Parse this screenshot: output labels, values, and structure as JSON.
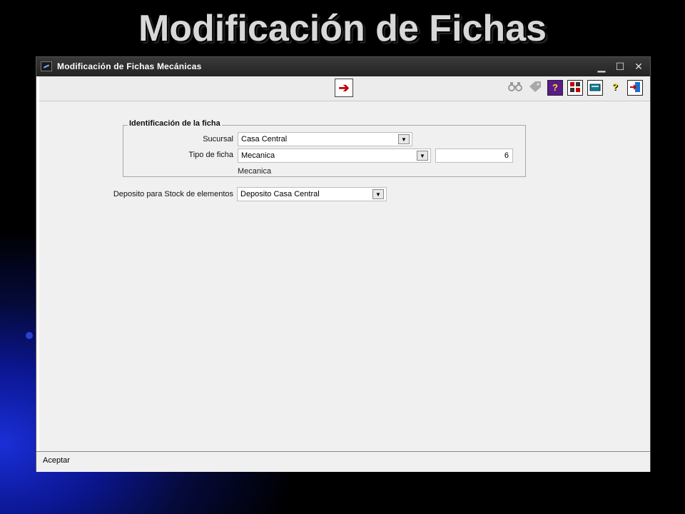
{
  "slide": {
    "title": "Modificación de Fichas"
  },
  "window": {
    "title": "Modificación de Fichas Mecánicas",
    "controls": {
      "minimize": "▁",
      "maximize": "☐",
      "close": "✕"
    }
  },
  "toolbar": {
    "accept_icon": "arrow-right-icon",
    "icons": [
      "binoculars-icon",
      "tag-icon",
      "help-question-icon",
      "calculator-grid-icon",
      "keyboard-icon",
      "help-yellow-icon",
      "exit-door-icon"
    ],
    "accent_colors": {
      "arrow": "#c00000",
      "purple": "#5b1a8c",
      "teal": "#0f7f8f",
      "yellow": "#f2d800"
    }
  },
  "form": {
    "group_label": "Identificación de la ficha",
    "sucursal": {
      "label": "Sucursal",
      "value": "Casa Central"
    },
    "tipo_ficha": {
      "label": "Tipo de ficha",
      "value": "Mecanica",
      "number": "6",
      "description": "Mecanica"
    },
    "deposito": {
      "label": "Deposito para Stock de elementos",
      "value": "Deposito Casa Central"
    }
  },
  "status": {
    "text": "Aceptar"
  }
}
